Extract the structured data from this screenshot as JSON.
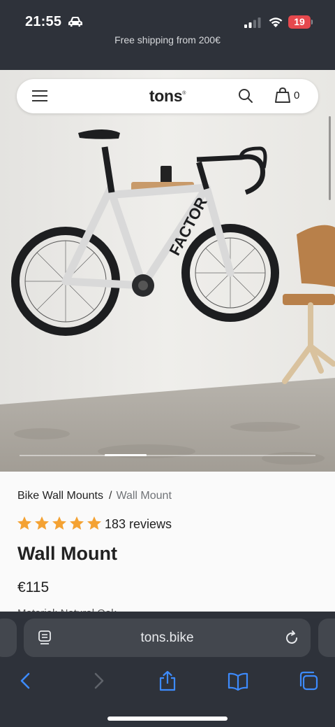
{
  "status_bar": {
    "time": "21:55",
    "battery": "19",
    "icons": [
      "car-icon",
      "signal-icon",
      "wifi-icon",
      "battery-icon"
    ]
  },
  "announcement": "Free shipping from 200€",
  "nav": {
    "logo": "tons",
    "logo_mark": "®",
    "cart_count": "0",
    "icons": [
      "menu-icon",
      "search-icon",
      "shopping-bag-icon"
    ]
  },
  "hero": {
    "image": "bike-on-wall-mount-photo",
    "bike_brand_text": "FACTOR",
    "carousel": {
      "slides": 4,
      "active": 2
    }
  },
  "product": {
    "breadcrumb": [
      {
        "label": "Bike Wall Mounts"
      },
      {
        "label": "Wall Mount"
      }
    ],
    "breadcrumb_separator": "/",
    "rating": 5,
    "reviews": "183 reviews",
    "title": "Wall Mount",
    "price": "€115",
    "material": "Material: Natural Oak"
  },
  "browser": {
    "url": "tons.bike",
    "toolbar": [
      "back-icon",
      "forward-icon",
      "share-icon",
      "bookmarks-icon",
      "tabs-icon"
    ]
  },
  "colors": {
    "chrome_bg": "#2e323a",
    "star": "#f4a233",
    "toolbar_icon": "#3d8bfd",
    "battery": "#e5484d"
  }
}
